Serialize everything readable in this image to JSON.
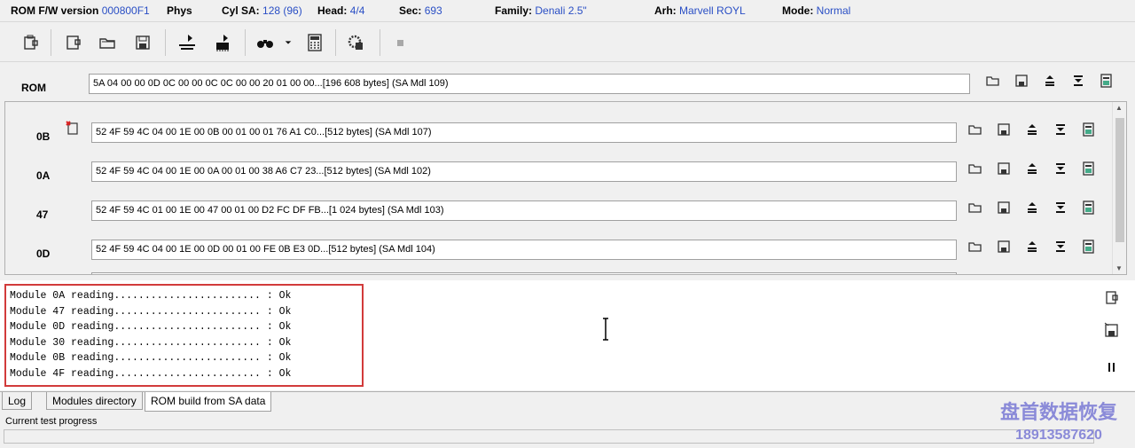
{
  "status": {
    "rom_fw_label": "ROM F/W version",
    "rom_fw_value": "000800F1",
    "phys_label": "Phys",
    "cyl_label": "Cyl SA:",
    "cyl_value": "128 (96)",
    "head_label": "Head:",
    "head_value": "4/4",
    "sec_label": "Sec:",
    "sec_value": "693",
    "family_label": "Family:",
    "family_value": "Denali 2.5\"",
    "arh_label": "Arh:",
    "arh_value": "Marvell ROYL",
    "mode_label": "Mode:",
    "mode_value": "Normal"
  },
  "rom": {
    "label": "ROM",
    "value": "5A 04 00 00 0D 0C 00 00 0C 0C 00 00 20 01 00 00...[196 608 bytes] (SA Mdl 109)"
  },
  "modules": [
    {
      "id": "0B",
      "value": "52 4F 59 4C 04 00 1E 00 0B 00 01 00 01 76 A1 C0...[512 bytes] (SA Mdl 107)"
    },
    {
      "id": "0A",
      "value": "52 4F 59 4C 04 00 1E 00 0A 00 01 00 38 A6 C7 23...[512 bytes] (SA Mdl 102)"
    },
    {
      "id": "47",
      "value": "52 4F 59 4C 01 00 1E 00 47 00 01 00 D2 FC DF FB...[1 024 bytes] (SA Mdl 103)"
    },
    {
      "id": "0D",
      "value": "52 4F 59 4C 04 00 1E 00 0D 00 01 00 FE 0B E3 0D...[512 bytes] (SA Mdl 104)"
    }
  ],
  "log": {
    "lines": [
      "Module 0A reading........................ : Ok",
      "Module 47 reading........................ : Ok",
      "Module 0D reading........................ : Ok",
      "Module 30 reading........................ : Ok",
      "Module 0B reading........................ : Ok",
      "Module 4F reading........................ : Ok"
    ]
  },
  "tabs": [
    "Log",
    "Modules directory",
    "ROM build from SA data"
  ],
  "active_tab": "ROM build from SA data",
  "progress_label": "Current test progress",
  "watermark": {
    "name": "盘首数据恢复",
    "phone": "18913587620"
  },
  "colors": {
    "value_blue": "#2a4fc5",
    "log_highlight": "#d23b3b",
    "watermark": "#8a8ad8"
  }
}
